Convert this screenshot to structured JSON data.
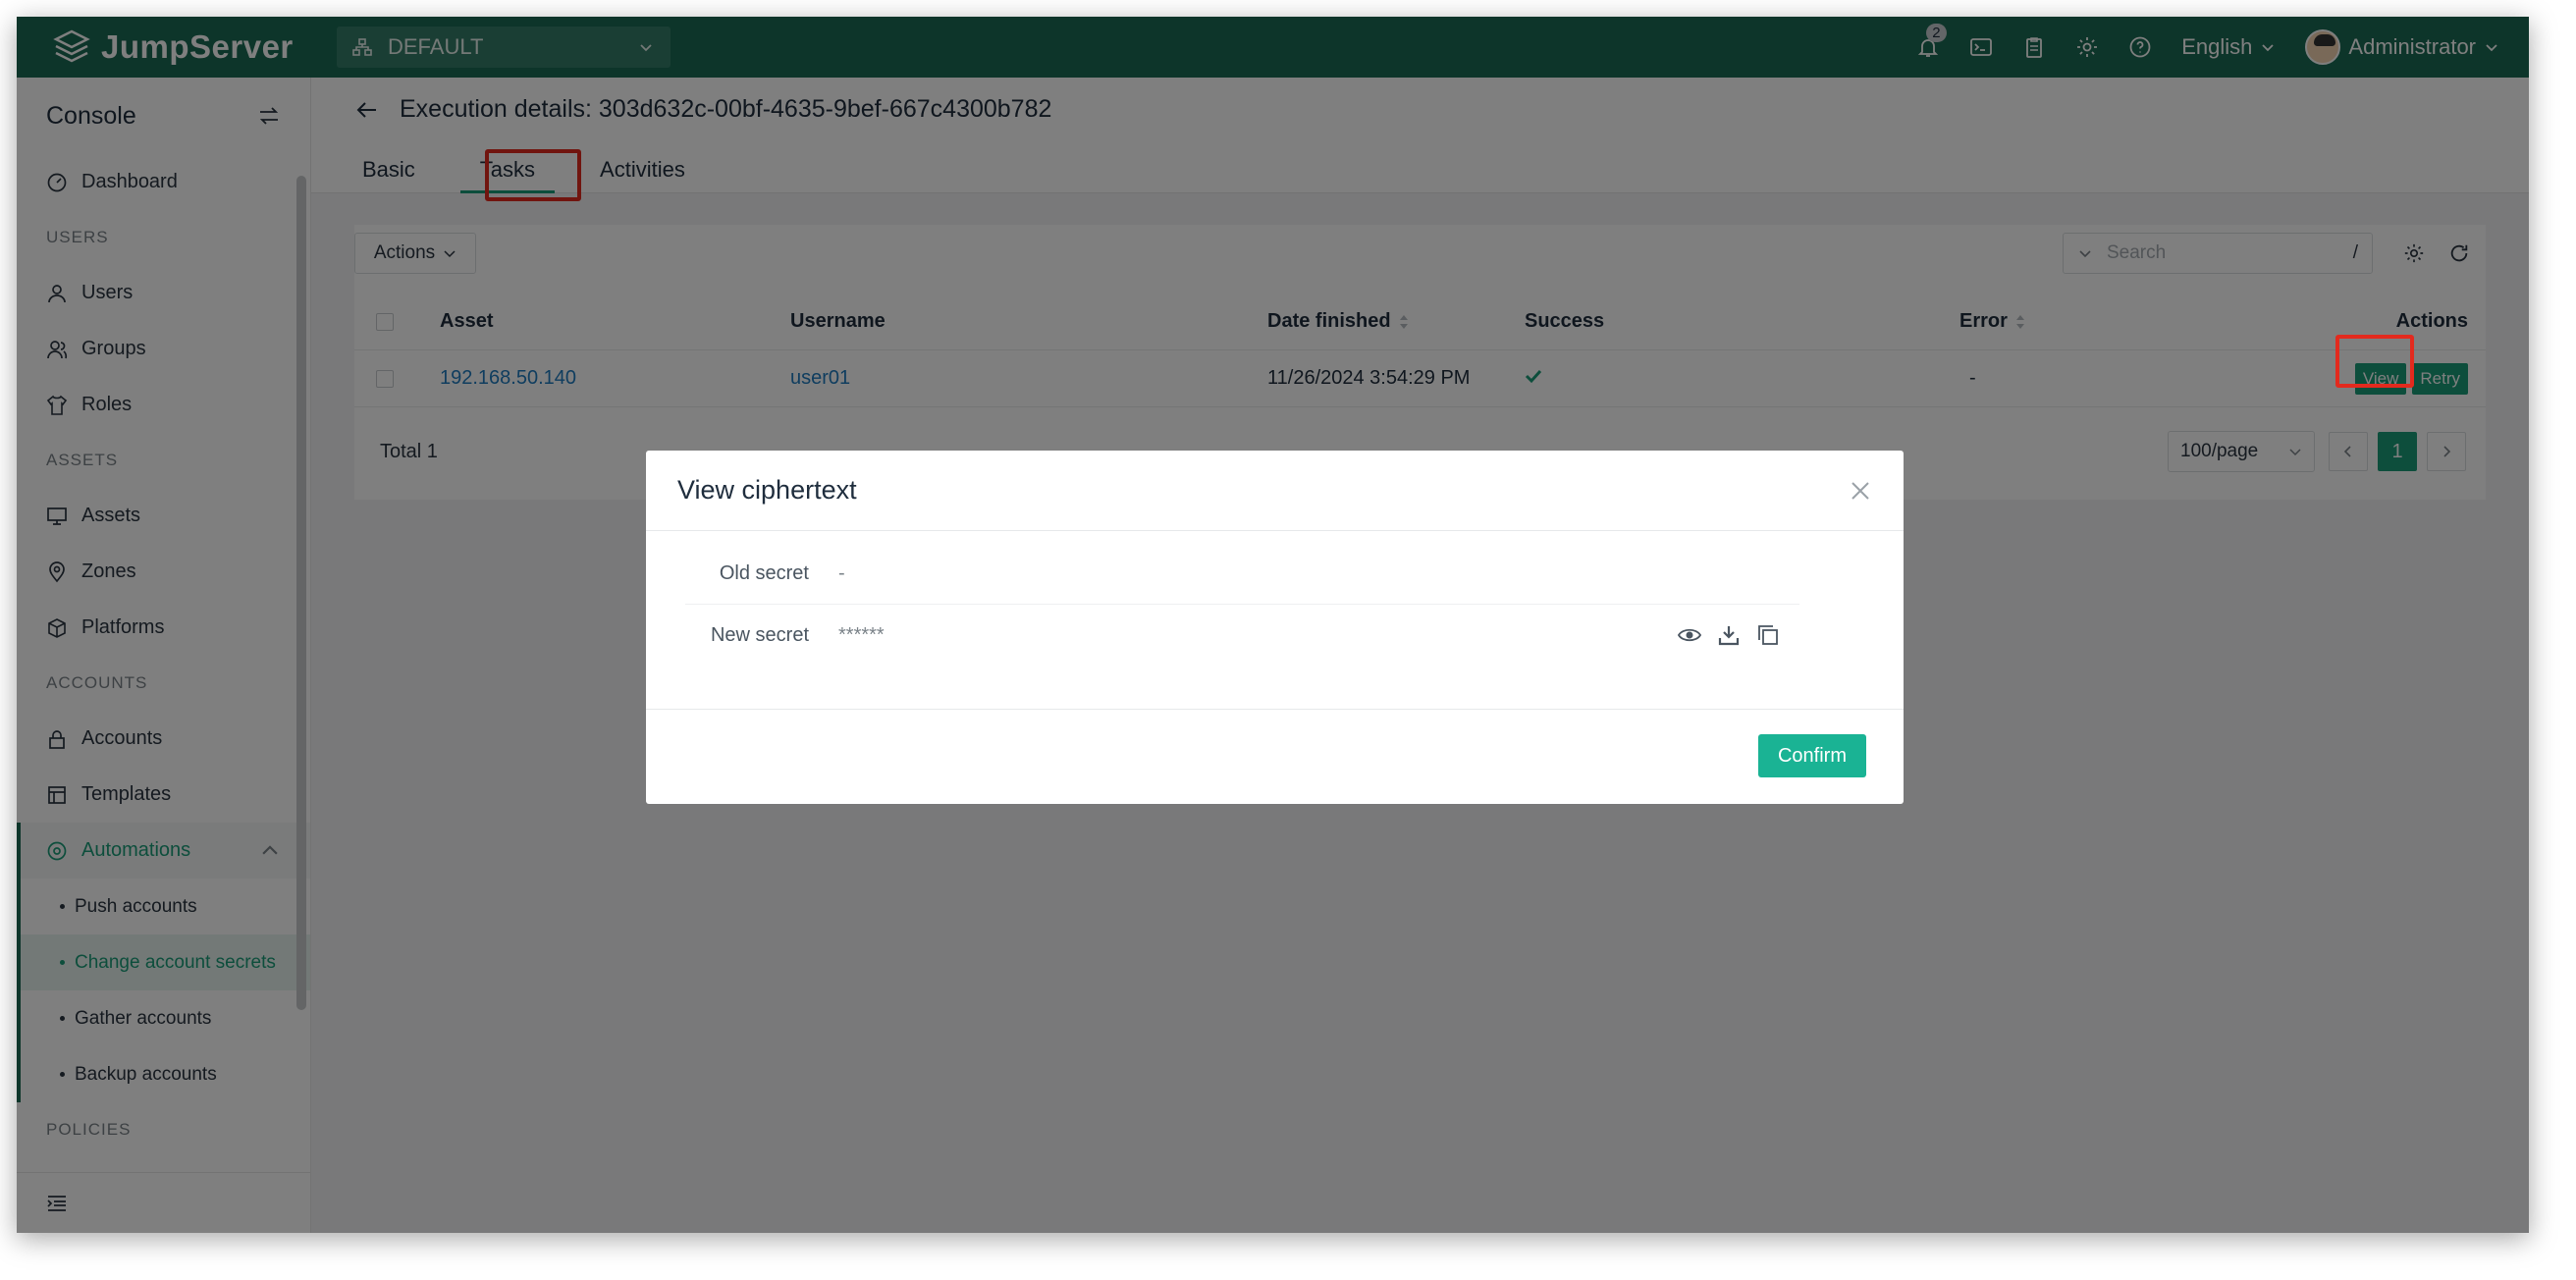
{
  "app": {
    "name": "JumpServer",
    "org": "DEFAULT",
    "notification_count": "2",
    "language": "English",
    "user": "Administrator"
  },
  "sidebar": {
    "title": "Console",
    "items": {
      "dashboard": "Dashboard",
      "users_section": "USERS",
      "users": "Users",
      "groups": "Groups",
      "roles": "Roles",
      "assets_section": "ASSETS",
      "assets": "Assets",
      "zones": "Zones",
      "platforms": "Platforms",
      "accounts_section": "ACCOUNTS",
      "accounts": "Accounts",
      "templates": "Templates",
      "automations": "Automations",
      "push_accounts": "Push accounts",
      "change_secrets": "Change account secrets",
      "gather_accounts": "Gather accounts",
      "backup_accounts": "Backup accounts",
      "policies_section": "POLICIES"
    }
  },
  "page": {
    "title": "Execution details: 303d632c-00bf-4635-9bef-667c4300b782",
    "tabs": [
      "Basic",
      "Tasks",
      "Activities"
    ],
    "active_tab": "Tasks"
  },
  "toolbar": {
    "actions_label": "Actions",
    "search_placeholder": "Search",
    "search_shortcut": "/"
  },
  "table": {
    "headers": {
      "asset": "Asset",
      "username": "Username",
      "date_finished": "Date finished",
      "success": "Success",
      "error": "Error",
      "actions": "Actions"
    },
    "rows": [
      {
        "asset": "192.168.50.140",
        "username": "user01",
        "date_finished": "11/26/2024 3:54:29 PM",
        "success": true,
        "error": "-",
        "view_label": "View",
        "retry_label": "Retry"
      }
    ]
  },
  "pagination": {
    "total": "Total 1",
    "page_size": "100/page",
    "current_page": "1"
  },
  "modal": {
    "title": "View ciphertext",
    "old_secret_label": "Old secret",
    "old_secret_value": "-",
    "new_secret_label": "New secret",
    "new_secret_value": "******",
    "confirm_label": "Confirm"
  },
  "colors": {
    "brand": "#1a6b54",
    "accent": "#1a9c78",
    "highlight": "#e32a1e"
  }
}
